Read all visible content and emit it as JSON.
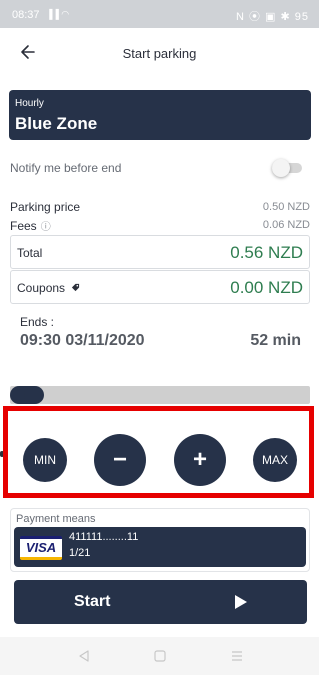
{
  "status_bar": {
    "time": "08:37",
    "signal_icons": "▐▐ ◠",
    "right_icons": "N ⦿ ▣ ✱ 95",
    "battery": "95"
  },
  "header": {
    "title": "Start parking"
  },
  "zone": {
    "type": "Hourly",
    "name": "Blue Zone"
  },
  "notify": {
    "label": "Notify me before end",
    "enabled": false
  },
  "pricing": {
    "parking_price_label": "Parking price",
    "parking_price_value": "0.50 NZD",
    "fees_label": "Fees",
    "fees_value": "0.06 NZD",
    "total_label": "Total",
    "total_value": "0.56 NZD",
    "coupons_label": "Coupons",
    "coupons_value": "0.00 NZD"
  },
  "ends": {
    "label": "Ends :",
    "datetime": "09:30 03/11/2020",
    "duration": "52 min"
  },
  "duration_slider": {
    "level_fraction": 0.05
  },
  "controls": {
    "min_label": "MIN",
    "minus_label": "−",
    "plus_label": "+",
    "max_label": "MAX"
  },
  "payment": {
    "label": "Payment means",
    "card_brand": "VISA",
    "card_number": "411111........11",
    "card_expiry": "1/21"
  },
  "start_button": {
    "label": "Start"
  },
  "colors": {
    "primary": "#263249",
    "total_green": "#2e7d4f",
    "highlight_red": "#e60000"
  },
  "icons": {
    "back": "arrow-left-icon",
    "info": "info-icon",
    "coupon": "tag-icon",
    "play": "play-icon",
    "nav_back": "triangle-back-icon",
    "nav_home": "square-home-icon",
    "nav_menu": "menu-lines-icon"
  }
}
